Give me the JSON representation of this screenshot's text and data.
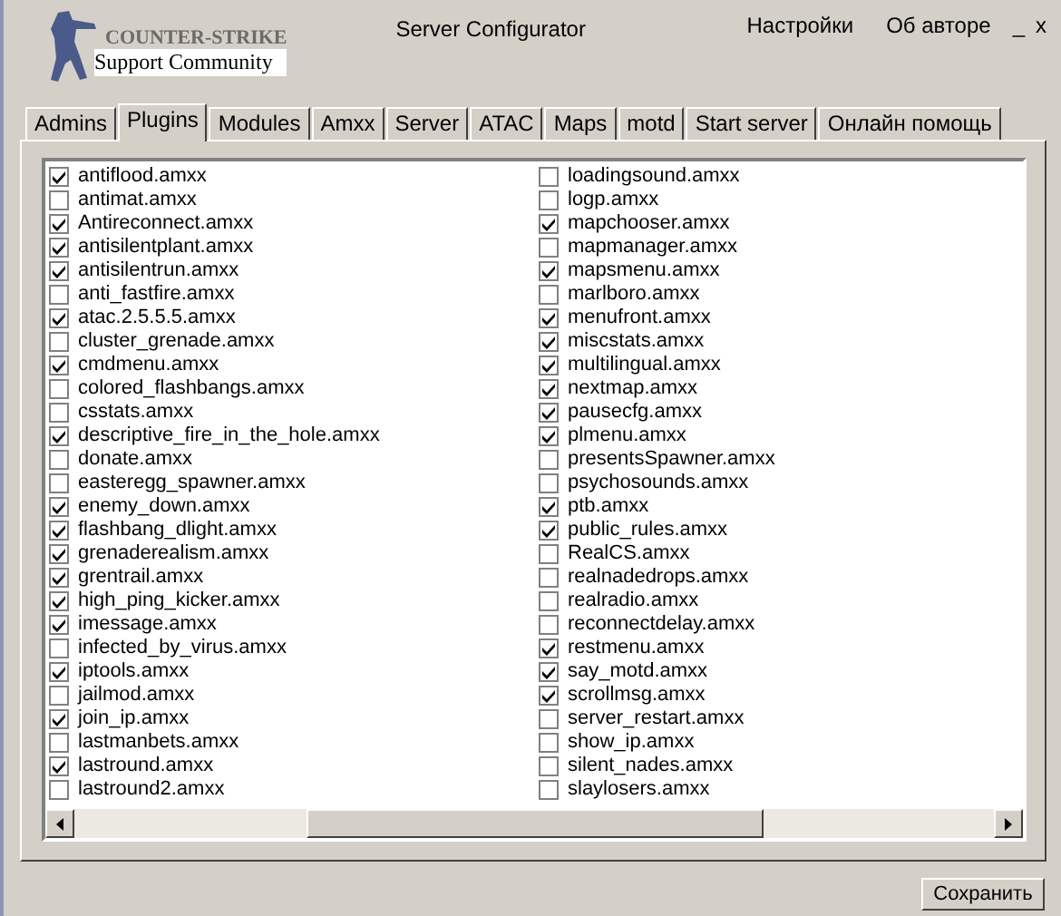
{
  "logo": {
    "title": "COUNTER-STRIKE",
    "subtitle": "Support Community"
  },
  "window": {
    "title": "Server Configurator"
  },
  "menu": [
    "Настройки",
    "Об авторе"
  ],
  "window_controls": [
    "_",
    "x"
  ],
  "tabs": [
    {
      "label": "Admins",
      "selected": false
    },
    {
      "label": "Plugins",
      "selected": true
    },
    {
      "label": "Modules",
      "selected": false
    },
    {
      "label": "Amxx",
      "selected": false
    },
    {
      "label": "Server",
      "selected": false
    },
    {
      "label": "ATAC",
      "selected": false
    },
    {
      "label": "Maps",
      "selected": false
    },
    {
      "label": "motd",
      "selected": false
    },
    {
      "label": "Start server",
      "selected": false
    },
    {
      "label": "Онлайн помощь",
      "selected": false
    }
  ],
  "plugins": [
    {
      "name": "antiflood.amxx",
      "checked": true
    },
    {
      "name": "antimat.amxx",
      "checked": false
    },
    {
      "name": "Antireconnect.amxx",
      "checked": true
    },
    {
      "name": "antisilentplant.amxx",
      "checked": true
    },
    {
      "name": "antisilentrun.amxx",
      "checked": true
    },
    {
      "name": "anti_fastfire.amxx",
      "checked": false
    },
    {
      "name": "atac.2.5.5.5.amxx",
      "checked": true
    },
    {
      "name": "cluster_grenade.amxx",
      "checked": false
    },
    {
      "name": "cmdmenu.amxx",
      "checked": true
    },
    {
      "name": "colored_flashbangs.amxx",
      "checked": false
    },
    {
      "name": "csstats.amxx",
      "checked": false
    },
    {
      "name": "descriptive_fire_in_the_hole.amxx",
      "checked": true
    },
    {
      "name": "donate.amxx",
      "checked": false
    },
    {
      "name": "easteregg_spawner.amxx",
      "checked": false
    },
    {
      "name": "enemy_down.amxx",
      "checked": true
    },
    {
      "name": "flashbang_dlight.amxx",
      "checked": true
    },
    {
      "name": "grenaderealism.amxx",
      "checked": true
    },
    {
      "name": "grentrail.amxx",
      "checked": true
    },
    {
      "name": "high_ping_kicker.amxx",
      "checked": true
    },
    {
      "name": "imessage.amxx",
      "checked": true
    },
    {
      "name": "infected_by_virus.amxx",
      "checked": false
    },
    {
      "name": "iptools.amxx",
      "checked": true
    },
    {
      "name": "jailmod.amxx",
      "checked": false
    },
    {
      "name": "join_ip.amxx",
      "checked": true
    },
    {
      "name": "lastmanbets.amxx",
      "checked": false
    },
    {
      "name": "lastround.amxx",
      "checked": true
    },
    {
      "name": "lastround2.amxx",
      "checked": false
    },
    {
      "name": "loadingsound.amxx",
      "checked": false
    },
    {
      "name": "logp.amxx",
      "checked": false
    },
    {
      "name": "mapchooser.amxx",
      "checked": true
    },
    {
      "name": "mapmanager.amxx",
      "checked": false
    },
    {
      "name": "mapsmenu.amxx",
      "checked": true
    },
    {
      "name": "marlboro.amxx",
      "checked": false
    },
    {
      "name": "menufront.amxx",
      "checked": true
    },
    {
      "name": "miscstats.amxx",
      "checked": true
    },
    {
      "name": "multilingual.amxx",
      "checked": true
    },
    {
      "name": "nextmap.amxx",
      "checked": true
    },
    {
      "name": "pausecfg.amxx",
      "checked": true
    },
    {
      "name": "plmenu.amxx",
      "checked": true
    },
    {
      "name": "presentsSpawner.amxx",
      "checked": false
    },
    {
      "name": "psychosounds.amxx",
      "checked": false
    },
    {
      "name": "ptb.amxx",
      "checked": true
    },
    {
      "name": "public_rules.amxx",
      "checked": true
    },
    {
      "name": "RealCS.amxx",
      "checked": false
    },
    {
      "name": "realnadedrops.amxx",
      "checked": false
    },
    {
      "name": "realradio.amxx",
      "checked": false
    },
    {
      "name": "reconnectdelay.amxx",
      "checked": false
    },
    {
      "name": "restmenu.amxx",
      "checked": true
    },
    {
      "name": "say_motd.amxx",
      "checked": true
    },
    {
      "name": "scrollmsg.amxx",
      "checked": true
    },
    {
      "name": "server_restart.amxx",
      "checked": false
    },
    {
      "name": "show_ip.amxx",
      "checked": false
    },
    {
      "name": "silent_nades.amxx",
      "checked": false
    },
    {
      "name": "slaylosers.amxx",
      "checked": false
    }
  ],
  "buttons": [
    "Сохранить"
  ]
}
